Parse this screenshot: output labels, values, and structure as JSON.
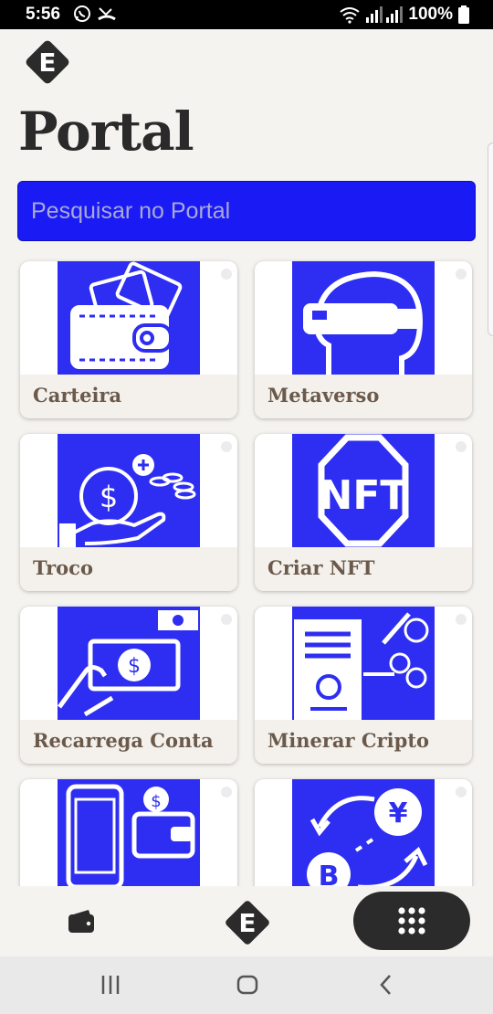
{
  "status_bar": {
    "time": "5:56",
    "battery": "100%",
    "icons": [
      "whatsapp-icon",
      "missed-call-icon",
      "wifi-icon",
      "signal-icon",
      "battery-icon"
    ]
  },
  "header": {
    "title": "Portal",
    "logo_letter": "E"
  },
  "search": {
    "placeholder": "Pesquisar no Portal"
  },
  "colors": {
    "accent_blue": "#2e2ef2",
    "search_bg": "#1a1af5",
    "label_brown": "#6b5a4c",
    "dark": "#2b2b2b"
  },
  "cards": [
    {
      "label": "Carteira",
      "icon": "wallet-icon"
    },
    {
      "label": "Metaverso",
      "icon": "vr-headset-icon"
    },
    {
      "label": "Troco",
      "icon": "coin-hand-icon"
    },
    {
      "label": "Criar NFT",
      "icon": "nft-icon"
    },
    {
      "label": "Recarrega Conta",
      "icon": "cash-recharge-icon"
    },
    {
      "label": "Minerar Cripto",
      "icon": "mining-rig-icon"
    },
    {
      "label": "",
      "icon": "phone-wallet-icon"
    },
    {
      "label": "",
      "icon": "crypto-exchange-icon"
    }
  ],
  "bottom_nav": {
    "items": [
      "wallet-icon",
      "logo-icon",
      "apps-grid-icon"
    ],
    "logo_letter": "E"
  },
  "android_nav": [
    "recents-icon",
    "home-icon",
    "back-icon"
  ]
}
